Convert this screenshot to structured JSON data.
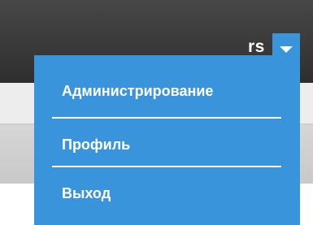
{
  "header": {
    "username": "rs",
    "toggle_icon": "chevron-down-icon"
  },
  "menu": {
    "items": [
      {
        "label": "Администрирование"
      },
      {
        "label": "Профиль"
      },
      {
        "label": "Выход"
      }
    ]
  },
  "colors": {
    "accent": "#3a94db",
    "topbar": "#3a3a3a",
    "menu_text": "#ffffff"
  }
}
